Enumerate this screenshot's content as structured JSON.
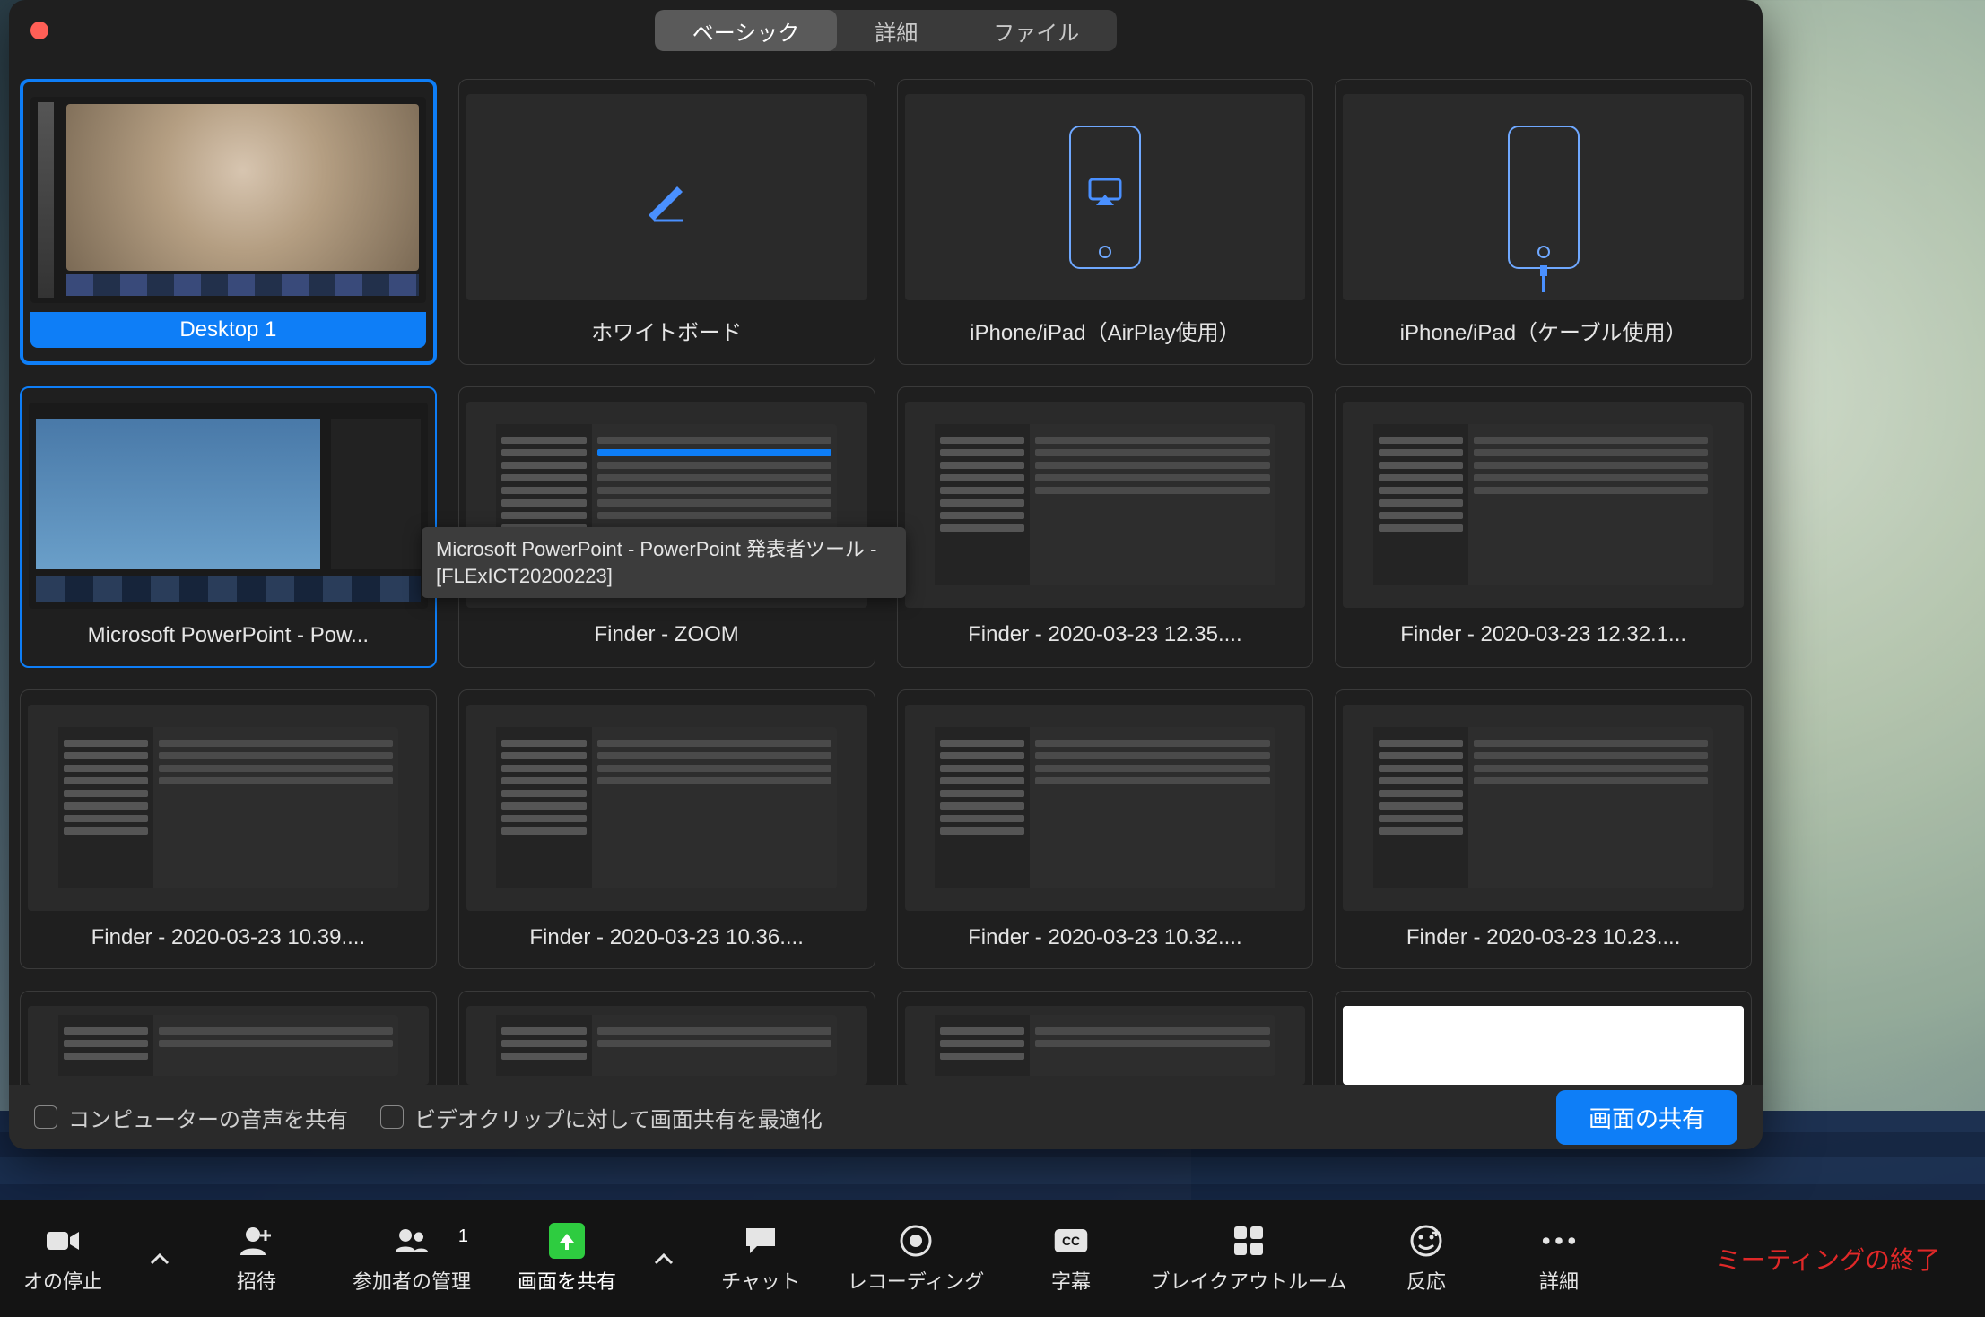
{
  "tabs": {
    "basic": "ベーシック",
    "advanced": "詳細",
    "files": "ファイル"
  },
  "sources": {
    "row1": [
      "Desktop 1",
      "ホワイトボード",
      "iPhone/iPad（AirPlay使用）",
      "iPhone/iPad（ケーブル使用）"
    ],
    "row2": [
      "Microsoft PowerPoint - Pow...",
      "Finder - ZOOM",
      "Finder - 2020-03-23 12.35....",
      "Finder - 2020-03-23 12.32.1..."
    ],
    "row3": [
      "Finder - 2020-03-23 10.39....",
      "Finder - 2020-03-23 10.36....",
      "Finder - 2020-03-23 10.32....",
      "Finder - 2020-03-23 10.23...."
    ]
  },
  "tooltip": "Microsoft PowerPoint - PowerPoint 発表者ツール - [FLExICT20200223]",
  "bottom": {
    "share_audio": "コンピューターの音声を共有",
    "optimize_video": "ビデオクリップに対して画面共有を最適化",
    "share_button": "画面の共有"
  },
  "toolbar": {
    "stop_video": "オの停止",
    "invite": "招待",
    "participants": "参加者の管理",
    "participants_count": "1",
    "share_screen": "画面を共有",
    "chat": "チャット",
    "recording": "レコーディング",
    "subtitles": "字幕",
    "breakout": "ブレイクアウトルーム",
    "reactions": "反応",
    "more": "詳細",
    "end_meeting": "ミーティングの終了"
  }
}
